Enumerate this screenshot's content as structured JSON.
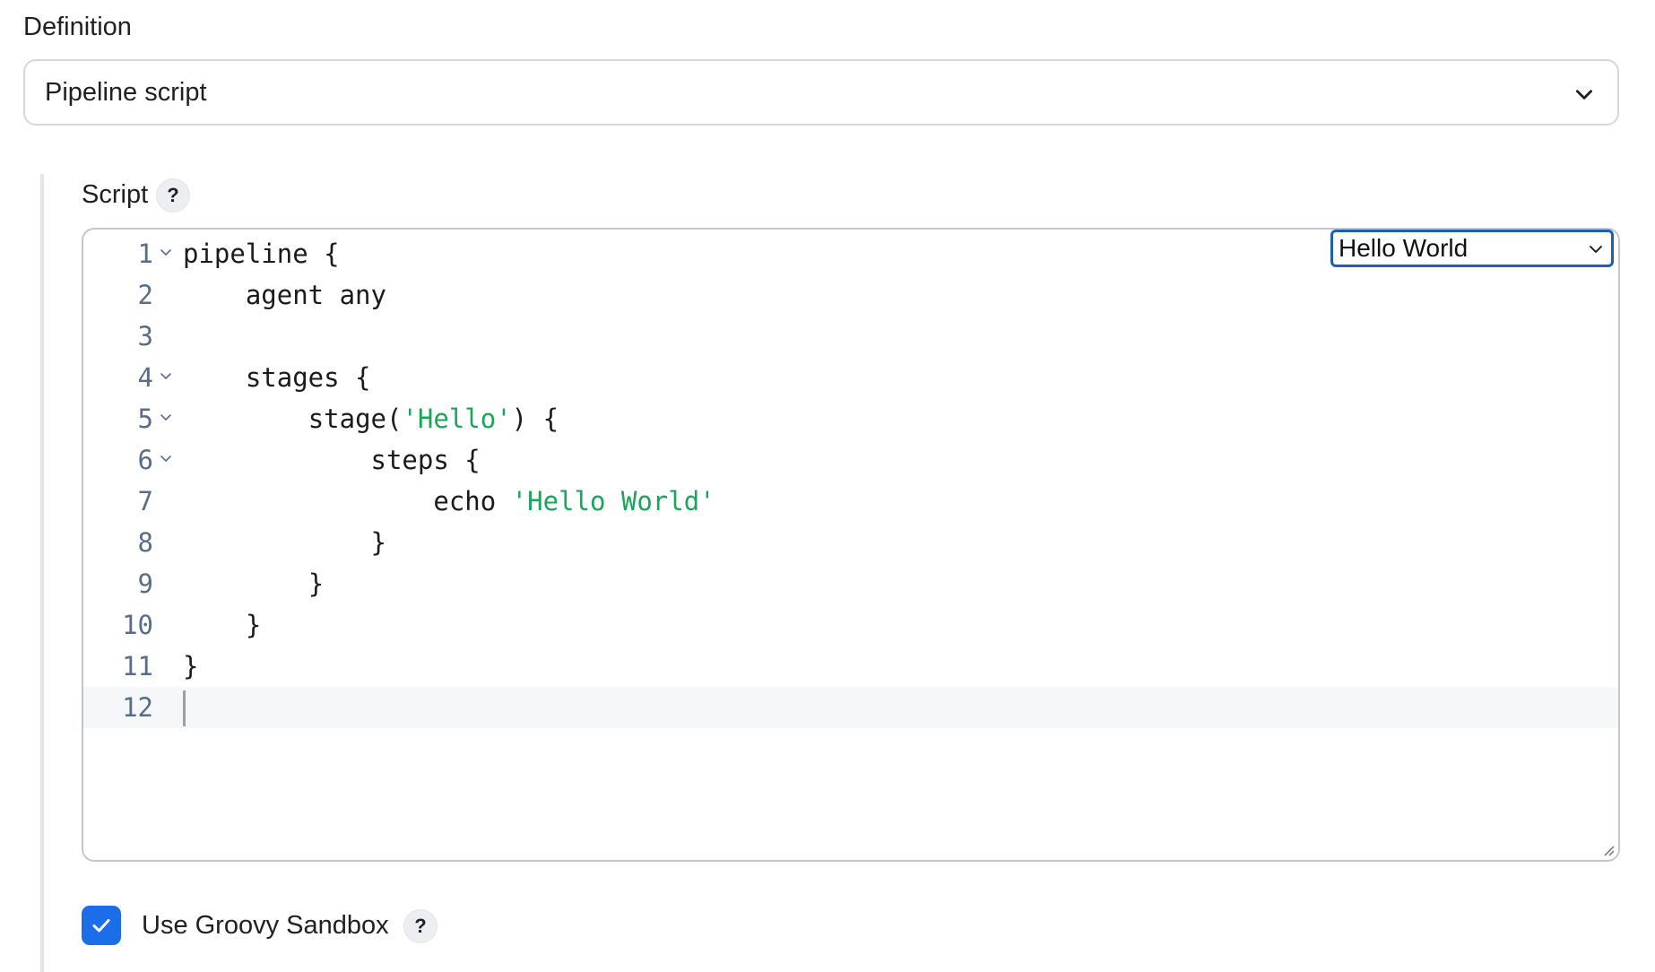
{
  "definition": {
    "label": "Definition",
    "selected": "Pipeline script",
    "icon": "chevron-down-icon"
  },
  "script": {
    "label": "Script",
    "help": "?",
    "template_selected": "Hello World",
    "lines": [
      {
        "num": "1",
        "indent": "",
        "parts": [
          {
            "t": "pipeline {",
            "k": "plain"
          }
        ],
        "fold": true
      },
      {
        "num": "2",
        "indent": "    ",
        "parts": [
          {
            "t": "agent any",
            "k": "plain"
          }
        ],
        "fold": false
      },
      {
        "num": "3",
        "indent": "",
        "parts": [],
        "fold": false
      },
      {
        "num": "4",
        "indent": "    ",
        "parts": [
          {
            "t": "stages {",
            "k": "plain"
          }
        ],
        "fold": true
      },
      {
        "num": "5",
        "indent": "        ",
        "parts": [
          {
            "t": "stage(",
            "k": "plain"
          },
          {
            "t": "'Hello'",
            "k": "string"
          },
          {
            "t": ") {",
            "k": "plain"
          }
        ],
        "fold": true
      },
      {
        "num": "6",
        "indent": "            ",
        "parts": [
          {
            "t": "steps {",
            "k": "plain"
          }
        ],
        "fold": true
      },
      {
        "num": "7",
        "indent": "                ",
        "parts": [
          {
            "t": "echo ",
            "k": "plain"
          },
          {
            "t": "'Hello World'",
            "k": "string"
          }
        ],
        "fold": false
      },
      {
        "num": "8",
        "indent": "            ",
        "parts": [
          {
            "t": "}",
            "k": "plain"
          }
        ],
        "fold": false
      },
      {
        "num": "9",
        "indent": "        ",
        "parts": [
          {
            "t": "}",
            "k": "plain"
          }
        ],
        "fold": false
      },
      {
        "num": "10",
        "indent": "    ",
        "parts": [
          {
            "t": "}",
            "k": "plain"
          }
        ],
        "fold": false
      },
      {
        "num": "11",
        "indent": "",
        "parts": [
          {
            "t": "}",
            "k": "plain"
          }
        ],
        "fold": false
      },
      {
        "num": "12",
        "indent": "",
        "parts": [],
        "fold": false,
        "active": true
      }
    ]
  },
  "sandbox": {
    "label": "Use Groovy Sandbox",
    "checked": true,
    "help": "?"
  },
  "colors": {
    "accent": "#1b6ee8",
    "string": "#1aa65a",
    "gutter": "#5a6d88",
    "select_focus": "#1c5fb8"
  }
}
